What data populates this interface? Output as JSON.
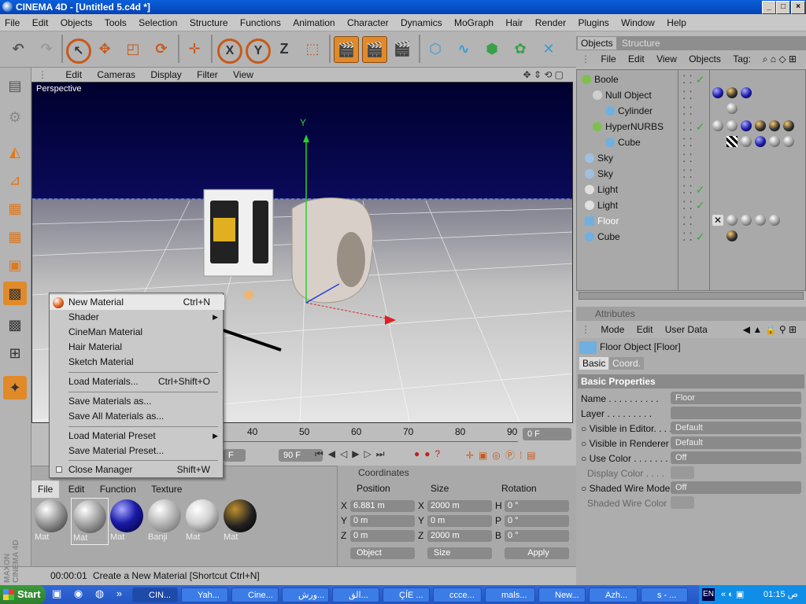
{
  "window": {
    "title": "CINEMA 4D - [Untitled 5.c4d *]",
    "minimize": "_",
    "maximize": "□",
    "close": "×"
  },
  "menubar": [
    "File",
    "Edit",
    "Objects",
    "Tools",
    "Selection",
    "Structure",
    "Functions",
    "Animation",
    "Character",
    "Dynamics",
    "MoGraph",
    "Hair",
    "Render",
    "Plugins",
    "Window",
    "Help"
  ],
  "toolbar": {
    "x_label": "X",
    "y_label": "Y",
    "z_label": "Z"
  },
  "viewport": {
    "menu": [
      "Edit",
      "Cameras",
      "Display",
      "Filter",
      "View"
    ],
    "label": "Perspective",
    "axis_y": "Y"
  },
  "timeline": {
    "ticks": [
      "40",
      "50",
      "60",
      "70",
      "80",
      "90"
    ],
    "current_frame": "0 F",
    "end_frame": "90 F",
    "frame_partial": "F"
  },
  "materials": {
    "menu": [
      "File",
      "Edit",
      "Function",
      "Texture"
    ],
    "items": [
      {
        "label": "Mat",
        "color": "#9a9a9a"
      },
      {
        "label": "Mat",
        "color": "#a5a5a5"
      },
      {
        "label": "Mat",
        "color": "#1a1aa8"
      },
      {
        "label": "Banji",
        "color": "#b8b8b8"
      },
      {
        "label": "Mat",
        "color": "#d0d0d0"
      },
      {
        "label": "Mat",
        "color": "#202020"
      }
    ]
  },
  "coordinates": {
    "title": "Coordinates",
    "headers": [
      "Position",
      "Size",
      "Rotation"
    ],
    "rows": [
      {
        "axis": "X",
        "pos": "6.881 m",
        "saxis": "X",
        "size": "2000 m",
        "raxis": "H",
        "rot": "0 °"
      },
      {
        "axis": "Y",
        "pos": "0 m",
        "saxis": "Y",
        "size": "0 m",
        "raxis": "P",
        "rot": "0 °"
      },
      {
        "axis": "Z",
        "pos": "0 m",
        "saxis": "Z",
        "size": "2000 m",
        "raxis": "B",
        "rot": "0 °"
      }
    ],
    "mode": "Object",
    "size_mode": "Size",
    "apply": "Apply"
  },
  "status": {
    "time": "00:00:01",
    "message": "Create a New Material [Shortcut Ctrl+N]"
  },
  "brand": {
    "line1": "MAXON",
    "line2": "CINEMA 4D"
  },
  "objects": {
    "tabs": [
      "Objects",
      "Structure"
    ],
    "menu": [
      "File",
      "Edit",
      "View",
      "Objects",
      "Tag:"
    ],
    "items": [
      {
        "name": "Boole",
        "indent": 0,
        "color": "#7fbf4f",
        "check": true
      },
      {
        "name": "Null Object",
        "indent": 1,
        "color": "#cfcfcf",
        "check": false
      },
      {
        "name": "Cylinder",
        "indent": 2,
        "color": "#6fb0e0",
        "check": false
      },
      {
        "name": "HyperNURBS",
        "indent": 1,
        "color": "#7fbf4f",
        "check": true
      },
      {
        "name": "Cube",
        "indent": 2,
        "color": "#6fb0e0",
        "check": false
      },
      {
        "name": "Sky",
        "indent": 0,
        "color": "#9fc0e0",
        "check": false
      },
      {
        "name": "Sky",
        "indent": 0,
        "color": "#9fc0e0",
        "check": false
      },
      {
        "name": "Light",
        "indent": 0,
        "color": "#e0e0e0",
        "check": true
      },
      {
        "name": "Light",
        "indent": 0,
        "color": "#e0e0e0",
        "check": true
      },
      {
        "name": "Floor",
        "indent": 0,
        "color": "#6fb0e0",
        "check": false,
        "highlight": true
      },
      {
        "name": "Cube",
        "indent": 0,
        "color": "#6fb0e0",
        "check": true
      }
    ]
  },
  "attributes": {
    "title": "Attributes",
    "menu": [
      "Mode",
      "Edit",
      "User Data"
    ],
    "object_title": "Floor Object [Floor]",
    "tabs": [
      "Basic",
      "Coord."
    ],
    "section": "Basic Properties",
    "rows": [
      {
        "label": "Name . . . . . . . . . .",
        "value": "Floor",
        "dim": false,
        "bullet": false
      },
      {
        "label": "Layer . . . . . . . . .",
        "value": "",
        "dim": false,
        "bullet": false
      },
      {
        "label": "Visible in Editor. . . .",
        "value": "Default",
        "dim": false,
        "bullet": true
      },
      {
        "label": "Visible in Renderer . .",
        "value": "Default",
        "dim": false,
        "bullet": true
      },
      {
        "label": "Use Color . . . . . . .",
        "value": "Off",
        "dim": false,
        "bullet": true
      },
      {
        "label": "Display Color . . . .",
        "value": "",
        "dim": true,
        "bullet": false
      },
      {
        "label": "Shaded Wire Mode",
        "value": "Off",
        "dim": false,
        "bullet": true
      },
      {
        "label": "Shaded Wire Color",
        "value": "",
        "dim": true,
        "bullet": false
      }
    ]
  },
  "context_menu": {
    "items": [
      {
        "label": "New Material",
        "shortcut": "Ctrl+N",
        "submenu": false
      },
      {
        "label": "Shader",
        "shortcut": "",
        "submenu": true
      },
      {
        "label": "CineMan Material",
        "shortcut": "",
        "submenu": false
      },
      {
        "label": "Hair Material",
        "shortcut": "",
        "submenu": false
      },
      {
        "label": "Sketch Material",
        "shortcut": "",
        "submenu": false
      },
      {
        "label": "Load Materials...",
        "shortcut": "Ctrl+Shift+O",
        "submenu": false
      },
      {
        "label": "Save Materials as...",
        "shortcut": "",
        "submenu": false
      },
      {
        "label": "Save All Materials as...",
        "shortcut": "",
        "submenu": false
      },
      {
        "label": "Load Material Preset",
        "shortcut": "",
        "submenu": true
      },
      {
        "label": "Save Material Preset...",
        "shortcut": "",
        "submenu": false
      },
      {
        "label": "Close Manager",
        "shortcut": "Shift+W",
        "submenu": false
      }
    ]
  },
  "taskbar": {
    "start": "Start",
    "tasks": [
      "CIN...",
      "Yah...",
      "Cine...",
      "ورش...",
      "الق...",
      "ÇÍE ...",
      "ccce...",
      "mals...",
      "New...",
      "Azh...",
      "s - ..."
    ],
    "lang": "EN",
    "clock": "01:15 ص"
  }
}
